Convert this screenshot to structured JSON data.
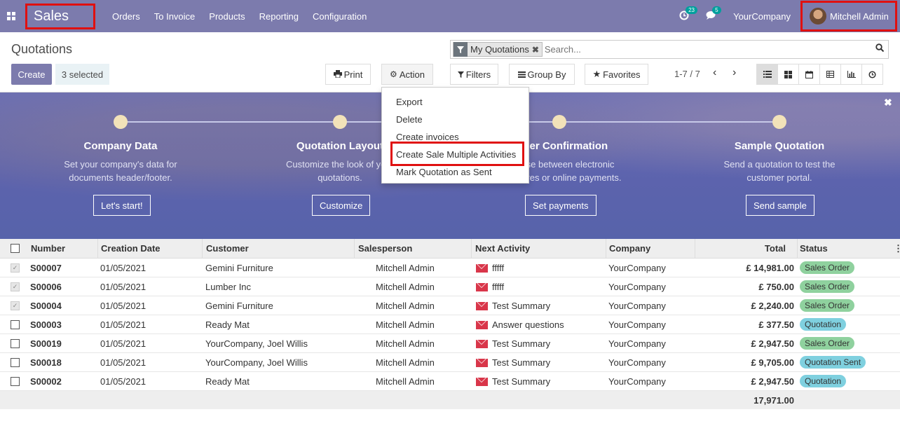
{
  "navbar": {
    "brand": "Sales",
    "menu": [
      "Orders",
      "To Invoice",
      "Products",
      "Reporting",
      "Configuration"
    ],
    "activity_count": "23",
    "message_count": "5",
    "company": "YourCompany",
    "user": "Mitchell Admin"
  },
  "control_panel": {
    "title": "Quotations",
    "create_label": "Create",
    "selected_label": "3 selected",
    "print_label": "Print",
    "action_label": "Action",
    "filters_label": "Filters",
    "group_by_label": "Group By",
    "favorites_label": "Favorites",
    "facet_label": "My Quotations",
    "search_placeholder": "Search...",
    "pager": "1-7 / 7"
  },
  "action_menu": {
    "items": [
      "Export",
      "Delete",
      "Create invoices",
      "Create Sale Multiple Activities",
      "Mark Quotation as Sent"
    ],
    "highlighted": "Create Sale Multiple Activities"
  },
  "banner": {
    "steps": [
      {
        "title": "Company Data",
        "desc1": "Set your company's data for",
        "desc2": "documents header/footer.",
        "button": "Let's start!"
      },
      {
        "title": "Quotation Layout",
        "desc1": "Customize the look of your",
        "desc2": "quotations.",
        "button": "Customize"
      },
      {
        "title": "Order Confirmation",
        "desc1": "Choose between electronic",
        "desc2": "signatures or online payments.",
        "button": "Set payments"
      },
      {
        "title": "Sample Quotation",
        "desc1": "Send a quotation to test the",
        "desc2": "customer portal.",
        "button": "Send sample"
      }
    ]
  },
  "table": {
    "headers": [
      "Number",
      "Creation Date",
      "Customer",
      "Salesperson",
      "Next Activity",
      "Company",
      "Total",
      "Status"
    ],
    "rows": [
      {
        "checked": true,
        "number": "S00007",
        "date": "01/05/2021",
        "customer": "Gemini Furniture",
        "salesperson": "Mitchell Admin",
        "activity": "fffff",
        "company": "YourCompany",
        "total": "£ 14,981.00",
        "status": "Sales Order"
      },
      {
        "checked": true,
        "number": "S00006",
        "date": "01/05/2021",
        "customer": "Lumber Inc",
        "salesperson": "Mitchell Admin",
        "activity": "fffff",
        "company": "YourCompany",
        "total": "£ 750.00",
        "status": "Sales Order"
      },
      {
        "checked": true,
        "number": "S00004",
        "date": "01/05/2021",
        "customer": "Gemini Furniture",
        "salesperson": "Mitchell Admin",
        "activity": "Test Summary",
        "company": "YourCompany",
        "total": "£ 2,240.00",
        "status": "Sales Order"
      },
      {
        "checked": false,
        "number": "S00003",
        "date": "01/05/2021",
        "customer": "Ready Mat",
        "salesperson": "Mitchell Admin",
        "activity": "Answer questions",
        "company": "YourCompany",
        "total": "£ 377.50",
        "status": "Quotation"
      },
      {
        "checked": false,
        "number": "S00019",
        "date": "01/05/2021",
        "customer": "YourCompany, Joel Willis",
        "salesperson": "Mitchell Admin",
        "activity": "Test Summary",
        "company": "YourCompany",
        "total": "£ 2,947.50",
        "status": "Sales Order"
      },
      {
        "checked": false,
        "number": "S00018",
        "date": "01/05/2021",
        "customer": "YourCompany, Joel Willis",
        "salesperson": "Mitchell Admin",
        "activity": "Test Summary",
        "company": "YourCompany",
        "total": "£ 9,705.00",
        "status": "Quotation Sent"
      },
      {
        "checked": false,
        "number": "S00002",
        "date": "01/05/2021",
        "customer": "Ready Mat",
        "salesperson": "Mitchell Admin",
        "activity": "Test Summary",
        "company": "YourCompany",
        "total": "£ 2,947.50",
        "status": "Quotation"
      }
    ],
    "footer_total": "17,971.00"
  }
}
